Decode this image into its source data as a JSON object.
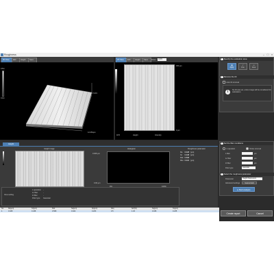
{
  "window": {
    "title": "Roughness"
  },
  "left_view": {
    "toolbar": [
      "3D View",
      "Edit",
      "Height",
      "Save"
    ],
    "scale_top": "0.5m",
    "scale_bottom": "0.0m",
    "label_z": "17.372",
    "label_x": "12.252μm"
  },
  "right_view": {
    "toolbar": [
      "2D View",
      "Edit",
      "Height",
      "Save"
    ],
    "zoom_label": "Zoom",
    "zoom_value": "100%",
    "labels": {
      "top_y": "360 μm",
      "bottom_x": "0 μm",
      "a": "18.5",
      "b": "Height",
      "c": "Intensity"
    }
  },
  "side_panel": {
    "section1": {
      "num": "1",
      "title": "Specify the evaluation area",
      "buttons": [
        "Apply",
        "Line",
        "Area"
      ]
    },
    "section2": {
      "num": "2",
      "title": "Remove the tilt",
      "checkbox_label": "Auto tilt removal",
      "info_text": "No tilt was set, entire image will be considered for calculation."
    },
    "section3": {
      "num": "3",
      "title": "Set the filter conditions",
      "radio_labels": [
        "λ operation",
        "Noise removal"
      ],
      "rows": [
        {
          "label": "λ filter",
          "value": "",
          "unit": "μm"
        },
        {
          "label": "λc filter",
          "value": "",
          "unit": "μm"
        },
        {
          "label": "λf filter",
          "value": "",
          "unit": "μm"
        }
      ],
      "filter_type_label": "Filter type",
      "filter_type_value": "Gaussian"
    },
    "section4": {
      "num": "4",
      "title": "Select the roughness parameter",
      "parameter_label": "Parameter",
      "parameter_value": "Height Parameters",
      "advanced_label": "Advanced settings",
      "advanced_value": "Support Edit",
      "start_button": "Start analysis"
    }
  },
  "bottom_panel": {
    "tab": "Height",
    "headers": [
      "Height image",
      "Histogram",
      "Roughness parameter"
    ],
    "hist_labels": {
      "top": "0.008 μm",
      "bottom": "0.00 μm",
      "x1": "0%",
      "x2": "100%"
    },
    "params": [
      {
        "name": "Ra",
        "value": "0.028",
        "unit": "[μm]"
      },
      {
        "name": "Sz",
        "value": "0.438",
        "unit": "[μm]"
      },
      {
        "name": "Rsk",
        "value": "0.568",
        "unit": ""
      },
      {
        "name": "Rku",
        "value": "0.022",
        "unit": "[μm]"
      }
    ],
    "view_setting": "View setting",
    "filters": [
      {
        "label": "λ operation",
        "value": "-"
      },
      {
        "label": "λc filter",
        "value": "-"
      },
      {
        "label": "λf filter",
        "value": "-"
      },
      {
        "label": "Filter type",
        "value": "Gaussian"
      }
    ]
  },
  "table": {
    "headers": [
      "No.",
      "Ra[μm]",
      "Sz[μm]",
      "Rsk",
      "Sa[μm]",
      "Sp[μm]",
      "Sdq",
      "Sdr[%]",
      "Sq[μm]",
      "Sv[μm]"
    ],
    "rows": [
      [
        "1",
        "0.028",
        "0.438",
        "0.568",
        "0.022",
        "0.203",
        "0.5",
        "1.03",
        "0.036",
        "0.235"
      ]
    ]
  },
  "actions": {
    "create_report": "Create report",
    "cancel": "Cancel"
  }
}
